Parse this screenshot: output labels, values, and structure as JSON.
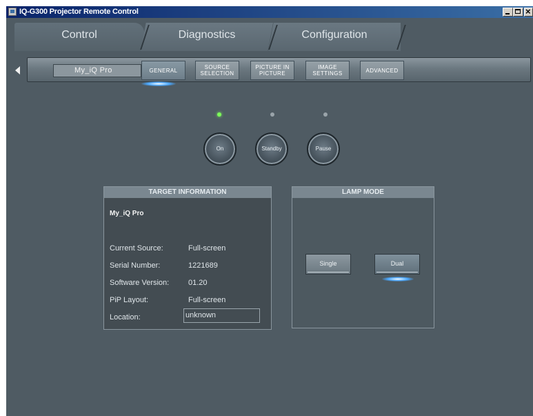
{
  "window": {
    "title": "IQ-G300 Projector Remote Control"
  },
  "tabs": [
    {
      "label": "Control",
      "active": true
    },
    {
      "label": "Diagnostics",
      "active": false
    },
    {
      "label": "Configuration",
      "active": false
    }
  ],
  "toolbar": {
    "target_name": "My_iQ Pro",
    "buttons": [
      {
        "label": "GENERAL",
        "active": true
      },
      {
        "label": "SOURCE SELECTION",
        "active": false
      },
      {
        "label": "PICTURE IN PICTURE",
        "active": false
      },
      {
        "label": "IMAGE SETTINGS",
        "active": false
      },
      {
        "label": "ADVANCED",
        "active": false
      }
    ]
  },
  "power": {
    "on_label": "On",
    "standby_label": "Standby",
    "pause_label": "Pause",
    "state": "On"
  },
  "target_info": {
    "header": "TARGET INFORMATION",
    "title": "My_iQ Pro",
    "rows": [
      {
        "label": "Current Source:",
        "value": "Full-screen"
      },
      {
        "label": "Serial Number:",
        "value": "1221689"
      },
      {
        "label": "Software Version:",
        "value": "01.20"
      },
      {
        "label": "PiP Layout:",
        "value": "Full-screen"
      },
      {
        "label": "Location:",
        "value": "unknown"
      }
    ]
  },
  "lamp_mode": {
    "header": "LAMP MODE",
    "single_label": "Single",
    "dual_label": "Dual",
    "selected": "Dual"
  },
  "colors": {
    "background": "#4f5b63",
    "active_glow": "#4aa8ff",
    "led_on": "#7dff5a"
  }
}
